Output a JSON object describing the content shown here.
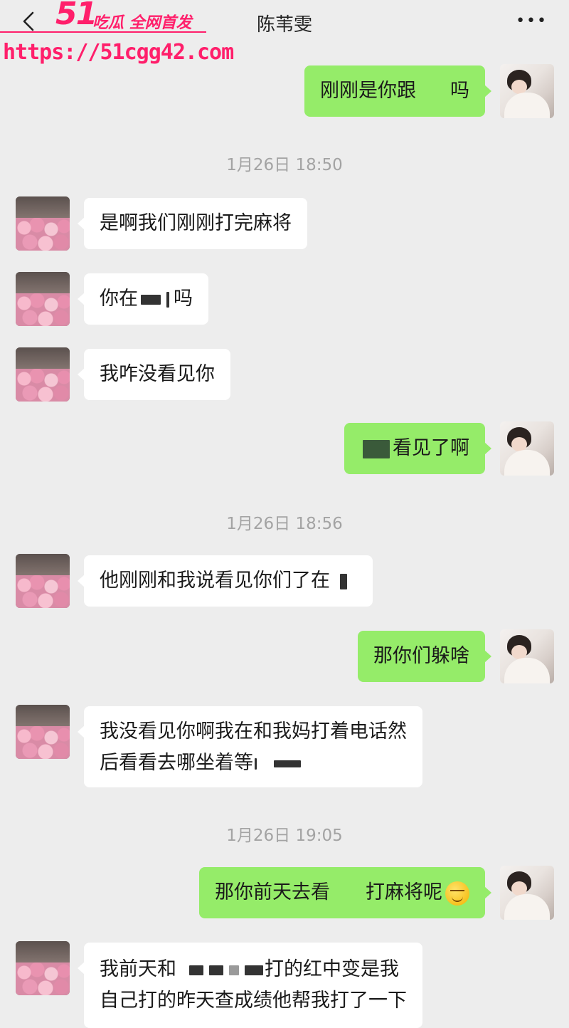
{
  "header": {
    "contact_name": "陈苇雯",
    "back_icon": "chevron-left-icon",
    "more_icon": "more-dots-icon",
    "more_label": "•••"
  },
  "watermark": {
    "logo": "51",
    "slogan": "吃瓜 全网首发",
    "url": "https://51cgg42.com",
    "color": "#ff1f6b"
  },
  "colors": {
    "incoming_bubble": "#ffffff",
    "outgoing_bubble": "#95ec69",
    "background": "#ededed",
    "timestamp": "#a3a3a3"
  },
  "messages": [
    {
      "id": "m1",
      "sender": "self",
      "parts": [
        "刚刚是你跟",
        "吗"
      ]
    },
    {
      "id": "t1",
      "type": "timestamp",
      "text": "1月26日 18:50"
    },
    {
      "id": "m2",
      "sender": "other",
      "parts": [
        "是啊我们刚刚打完麻将"
      ]
    },
    {
      "id": "m3",
      "sender": "other",
      "parts": [
        "你在",
        "吗"
      ]
    },
    {
      "id": "m4",
      "sender": "other",
      "parts": [
        "我咋没看见你"
      ]
    },
    {
      "id": "m5",
      "sender": "self",
      "parts": [
        "看见了啊"
      ]
    },
    {
      "id": "t2",
      "type": "timestamp",
      "text": "1月26日 18:56"
    },
    {
      "id": "m6",
      "sender": "other",
      "parts": [
        "他刚刚和我说看见你们了在"
      ]
    },
    {
      "id": "m7",
      "sender": "self",
      "parts": [
        "那你们躲啥"
      ]
    },
    {
      "id": "m8",
      "sender": "other",
      "lines": [
        "我没看见你啊我在和我妈打着电话然",
        "后看看去哪坐着等"
      ]
    },
    {
      "id": "t3",
      "type": "timestamp",
      "text": "1月26日 19:05"
    },
    {
      "id": "m9",
      "sender": "self",
      "parts": [
        "那你前天去看",
        "打麻将呢"
      ],
      "emoji": "smirk-emoji"
    },
    {
      "id": "m10",
      "sender": "other",
      "lines": [
        "我前天和",
        "打的红中变是我",
        "自己打的昨天查成绩他帮我打了一下"
      ]
    }
  ]
}
